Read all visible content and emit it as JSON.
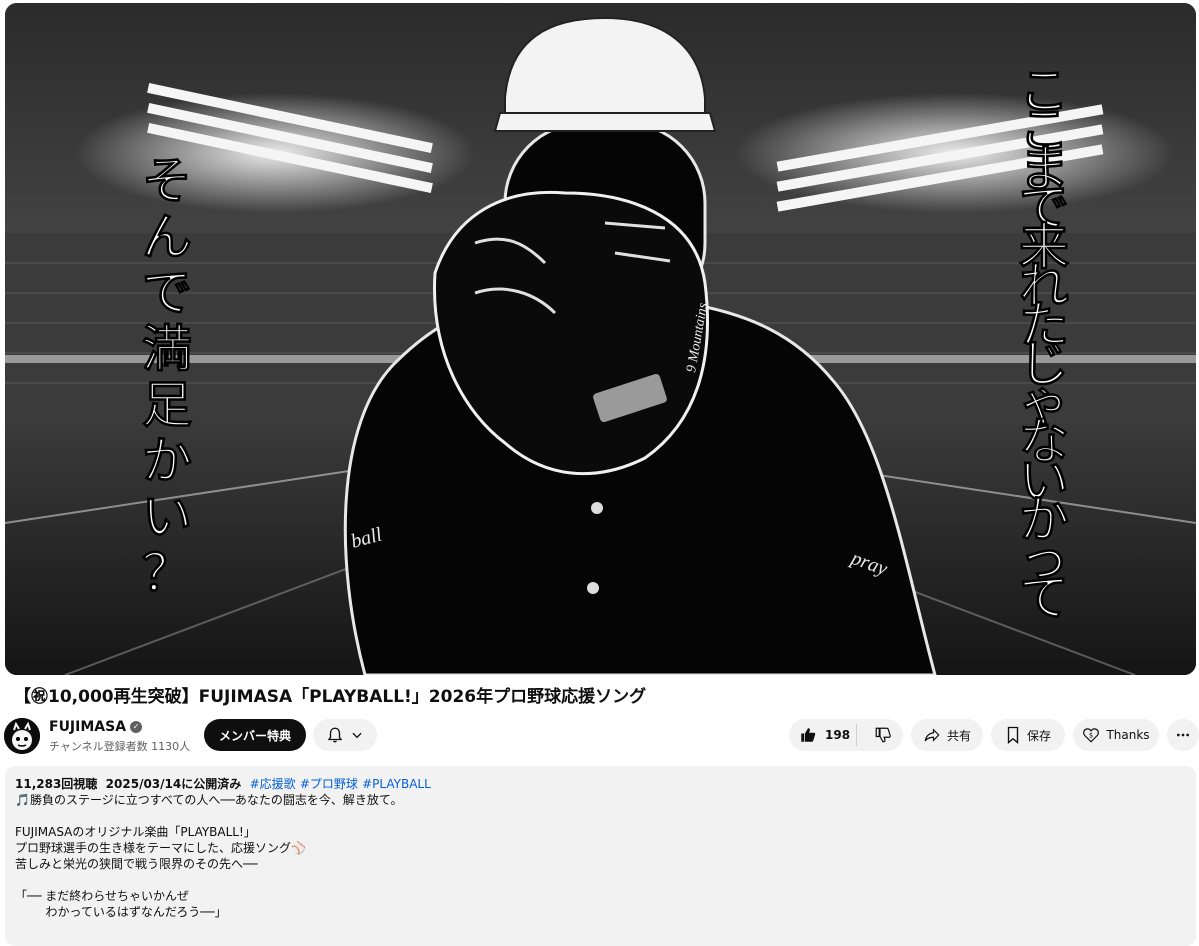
{
  "video": {
    "title": "【㊗10,000再生突破】FUJIMASA「PLAYBALL!」2026年プロ野球応援ソング",
    "thumbnail": {
      "left_text": "そんで満足かい？",
      "right_text": "ここまで来れたじゃないかって",
      "sleeve_left": "ball",
      "sleeve_right": "pray",
      "glove_text": "9 Mountains"
    }
  },
  "channel": {
    "name": "FUJIMASA",
    "subscribers": "チャンネル登録者数 1130人",
    "verified_icon": "verified-check-icon"
  },
  "actions": {
    "member_label": "メンバー特典",
    "like_count": "198",
    "share_label": "共有",
    "save_label": "保存",
    "thanks_label": "Thanks"
  },
  "description": {
    "views": "11,283回視聴",
    "date": "2025/03/14に公開済み",
    "tags": [
      "#応援歌",
      "#プロ野球",
      "#PLAYBALL"
    ],
    "lines": [
      "🎵勝負のステージに立つすべての人へ──あなたの闘志を今、解き放て。",
      "",
      "FUJIMASAのオリジナル楽曲「PLAYBALL!」",
      "プロ野球選手の生き様をテーマにした、応援ソング⚾",
      "苦しみと栄光の狭間で戦う限界のその先へ──",
      "",
      "「── まだ終わらせちゃいかんぜ",
      "        わかっているはずなんだろう──」"
    ]
  },
  "colors": {
    "accent_link": "#065fd4",
    "button_bg": "#f2f2f2",
    "dark_button": "#0f0f0f"
  }
}
